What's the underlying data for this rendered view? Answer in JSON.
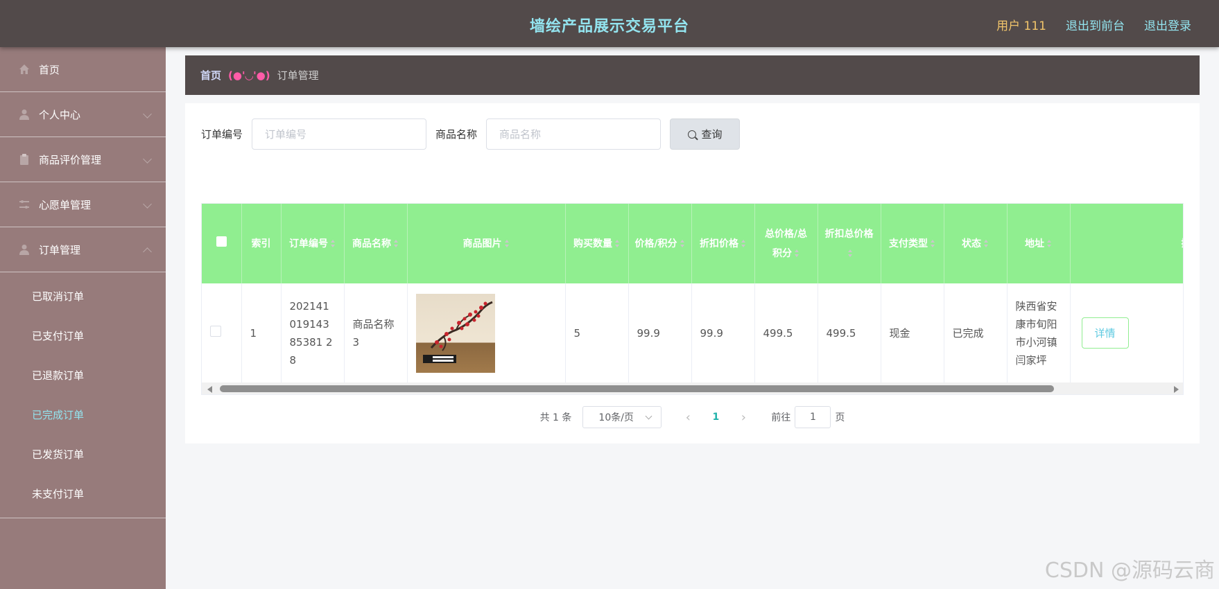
{
  "header": {
    "title": "墙绘产品展示交易平台",
    "user_label": "用户 111",
    "to_front_label": "退出到前台",
    "logout_label": "退出登录"
  },
  "sidebar": {
    "items": [
      {
        "label": "首页",
        "icon": "home-icon"
      },
      {
        "label": "个人中心",
        "icon": "user-icon"
      },
      {
        "label": "商品评价管理",
        "icon": "clipboard-icon"
      },
      {
        "label": "心愿单管理",
        "icon": "sliders-icon"
      },
      {
        "label": "订单管理",
        "icon": "user-icon"
      }
    ],
    "order_submenu": [
      {
        "label": "已取消订单"
      },
      {
        "label": "已支付订单"
      },
      {
        "label": "已退款订单"
      },
      {
        "label": "已完成订单",
        "active": true
      },
      {
        "label": "已发货订单"
      },
      {
        "label": "未支付订单"
      }
    ]
  },
  "breadcrumb": {
    "home": "首页",
    "separator": "(●'◡'●)",
    "current": "订单管理"
  },
  "search": {
    "order_no_label": "订单编号",
    "order_no_placeholder": "订单编号",
    "product_name_label": "商品名称",
    "product_name_placeholder": "商品名称",
    "query_label": "查询"
  },
  "table": {
    "columns": [
      "索引",
      "订单编号",
      "商品名称",
      "商品图片",
      "购买数量",
      "价格/积分",
      "折扣价格",
      "总价格/总积分",
      "折扣总价格",
      "支付类型",
      "状态",
      "地址",
      "操作"
    ],
    "rows": [
      {
        "index": "1",
        "order_no": "20214101914385381 28",
        "product_name": "商品名称3",
        "image_alt": "wall-painting-thumbnail",
        "quantity": "5",
        "price": "99.9",
        "discount_price": "99.9",
        "total_price": "499.5",
        "discount_total": "499.5",
        "pay_type": "现金",
        "status": "已完成",
        "address": "陕西省安康市旬阳市小河镇闫家坪",
        "detail_label": "详情"
      }
    ]
  },
  "pagination": {
    "total_text": "共 1 条",
    "page_size": "10条/页",
    "current_page": "1",
    "goto_label": "前往",
    "goto_value": "1",
    "page_suffix": "页"
  },
  "watermark": "CSDN @源码云商",
  "colors": {
    "header_bg": "#524a4a",
    "sidebar_bg": "#977b7b",
    "table_header_bg": "#90ee90",
    "accent_cyan": "#93e4ef",
    "user_gold": "#f2c56b"
  }
}
